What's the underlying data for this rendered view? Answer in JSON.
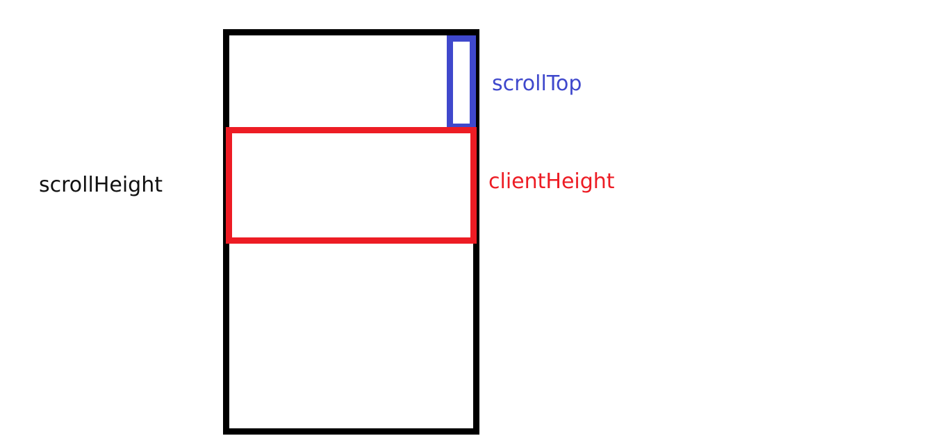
{
  "labels": {
    "scroll_height": "scrollHeight",
    "scroll_top": "scrollTop",
    "client_height": "clientHeight"
  },
  "colors": {
    "scroll_height": "#000000",
    "scroll_top": "#3f48cc",
    "client_height": "#ed1c24"
  }
}
